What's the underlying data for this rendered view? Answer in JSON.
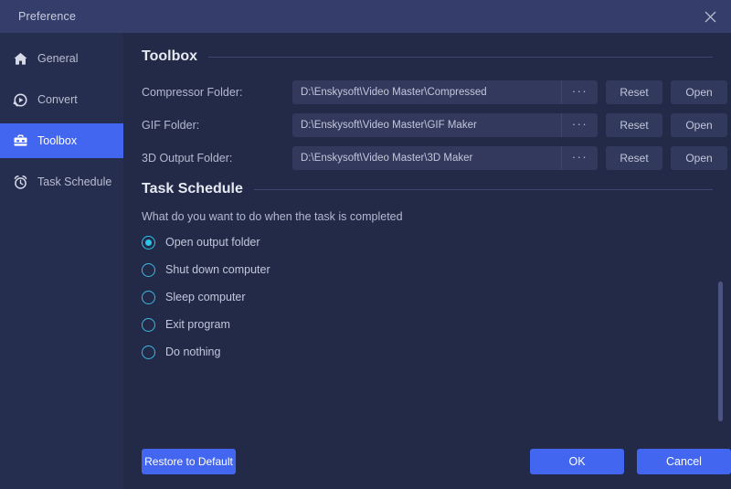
{
  "titlebar": {
    "title": "Preference",
    "close_icon": "close-icon"
  },
  "sidebar": {
    "items": [
      {
        "label": "General",
        "icon": "home-icon",
        "active": false
      },
      {
        "label": "Convert",
        "icon": "convert-icon",
        "active": false
      },
      {
        "label": "Toolbox",
        "icon": "briefcase-icon",
        "active": true
      },
      {
        "label": "Task Schedule",
        "icon": "alarm-clock-icon",
        "active": false
      }
    ]
  },
  "toolbox": {
    "heading": "Toolbox",
    "rows": [
      {
        "label": "Compressor Folder:",
        "path": "D:\\Enskysoft\\Video Master\\Compressed",
        "browse_label": "···",
        "reset_label": "Reset",
        "open_label": "Open"
      },
      {
        "label": "GIF Folder:",
        "path": "D:\\Enskysoft\\Video Master\\GIF Maker",
        "browse_label": "···",
        "reset_label": "Reset",
        "open_label": "Open"
      },
      {
        "label": "3D Output Folder:",
        "path": "D:\\Enskysoft\\Video Master\\3D Maker",
        "browse_label": "···",
        "reset_label": "Reset",
        "open_label": "Open"
      }
    ]
  },
  "task_schedule": {
    "heading": "Task Schedule",
    "subtitle": "What do you want to do when the task is completed",
    "options": [
      {
        "label": "Open output folder",
        "selected": true
      },
      {
        "label": "Shut down computer",
        "selected": false
      },
      {
        "label": "Sleep computer",
        "selected": false
      },
      {
        "label": "Exit program",
        "selected": false
      },
      {
        "label": "Do nothing",
        "selected": false
      }
    ]
  },
  "footer": {
    "restore_label": "Restore to Default",
    "ok_label": "OK",
    "cancel_label": "Cancel"
  },
  "colors": {
    "window_bg": "#222a47",
    "titlebar_bg": "#353e6b",
    "sidebar_bg": "#262e50",
    "accent": "#4266f0",
    "radio_accent": "#2ec4e8",
    "field_bg": "#32395d"
  }
}
